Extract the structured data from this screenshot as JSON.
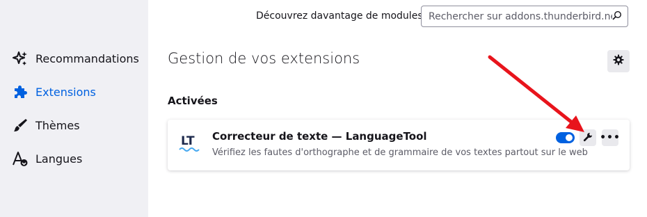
{
  "sidebar": {
    "items": [
      {
        "label": "Recommandations",
        "icon": "sparkles-icon",
        "active": false
      },
      {
        "label": "Extensions",
        "icon": "puzzle-icon",
        "active": true
      },
      {
        "label": "Thèmes",
        "icon": "brush-icon",
        "active": false
      },
      {
        "label": "Langues",
        "icon": "language-icon",
        "active": false
      }
    ]
  },
  "header": {
    "search_label": "Découvrez davantage de modules",
    "search_placeholder": "Rechercher sur addons.thunderbird.net"
  },
  "main": {
    "title": "Gestion de vos extensions",
    "section_title": "Activées",
    "addons": [
      {
        "name": "Correcteur de texte — LanguageTool",
        "description": "Vérifiez les fautes d'orthographe et de grammaire de vos textes partout sur le web",
        "enabled": true,
        "logo_text": "LT"
      }
    ],
    "more_label": "•••"
  },
  "colors": {
    "accent": "#0061e0",
    "sidebar_bg": "#f0f0f4",
    "annotation_arrow": "#e8141c"
  }
}
